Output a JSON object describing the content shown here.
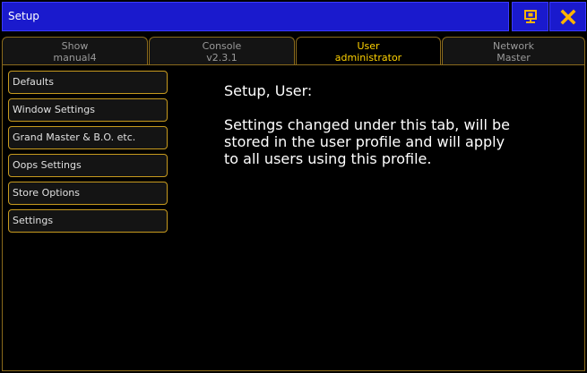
{
  "window": {
    "title": "Setup"
  },
  "titlebar": {
    "display_icon": "display-icon",
    "close_icon": "close-icon",
    "accent_color": "#ffb400",
    "bar_color": "#1a1acd"
  },
  "tabs": [
    {
      "label": "Show",
      "sub": "manual4",
      "active": false
    },
    {
      "label": "Console",
      "sub": "v2.3.1",
      "active": false
    },
    {
      "label": "User",
      "sub": "administrator",
      "active": true
    },
    {
      "label": "Network",
      "sub": "Master",
      "active": false
    }
  ],
  "sidebar": {
    "items": [
      {
        "label": "Defaults"
      },
      {
        "label": "Window Settings"
      },
      {
        "label": "Grand Master & B.O. etc."
      },
      {
        "label": "Oops Settings"
      },
      {
        "label": "Store Options"
      },
      {
        "label": "Settings"
      }
    ]
  },
  "info": {
    "heading": "Setup, User:",
    "body": "Settings changed under this tab, will be stored in the user profile and will apply to all users using this profile."
  }
}
